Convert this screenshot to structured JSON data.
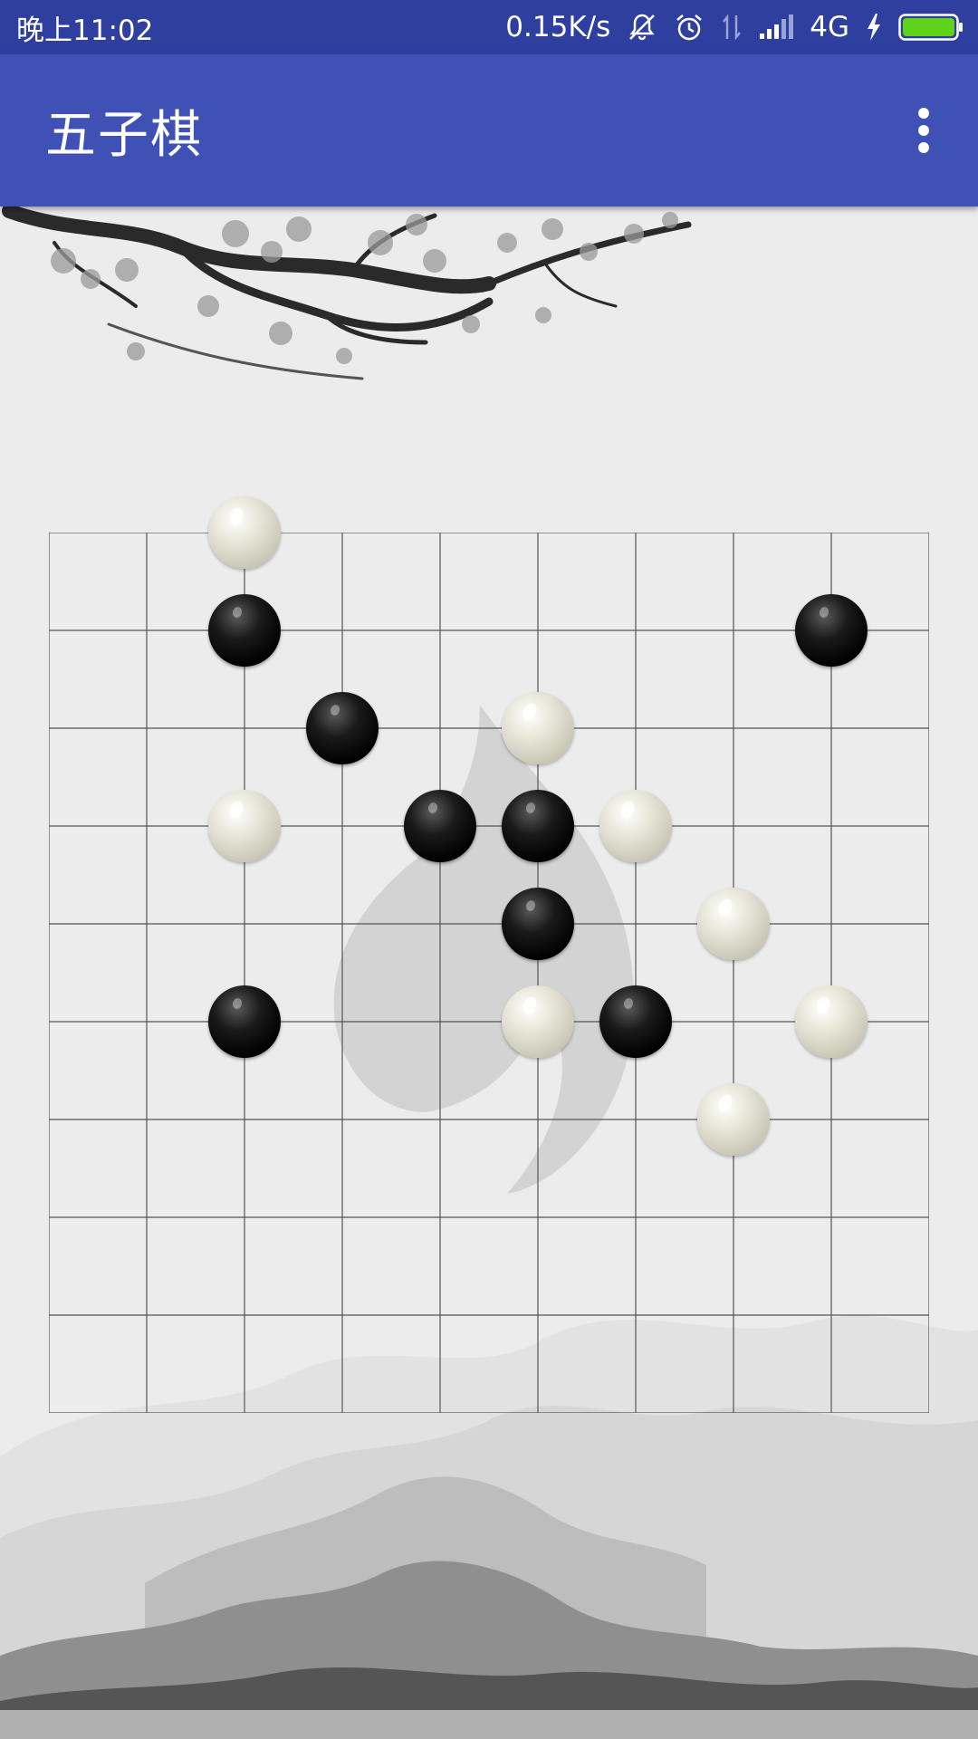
{
  "status_bar": {
    "time": "晚上11:02",
    "speed": "0.15K/s",
    "network": "4G",
    "icons": [
      "silent-icon",
      "alarm-icon",
      "data-arrows-icon",
      "signal-icon",
      "charging-icon",
      "battery-icon"
    ]
  },
  "app_bar": {
    "title": "五子棋",
    "menu_icon": "more-vert-icon",
    "color": "#3f51b5",
    "status_color": "#2f3f9f"
  },
  "board": {
    "lines": 10,
    "stones": [
      {
        "color": "white",
        "col": 2,
        "row": 0
      },
      {
        "color": "black",
        "col": 2,
        "row": 1
      },
      {
        "color": "black",
        "col": 8,
        "row": 1
      },
      {
        "color": "black",
        "col": 3,
        "row": 2
      },
      {
        "color": "white",
        "col": 5,
        "row": 2
      },
      {
        "color": "white",
        "col": 2,
        "row": 3
      },
      {
        "color": "black",
        "col": 4,
        "row": 3
      },
      {
        "color": "black",
        "col": 5,
        "row": 3
      },
      {
        "color": "white",
        "col": 6,
        "row": 3
      },
      {
        "color": "black",
        "col": 5,
        "row": 4
      },
      {
        "color": "white",
        "col": 7,
        "row": 4
      },
      {
        "color": "black",
        "col": 2,
        "row": 5
      },
      {
        "color": "white",
        "col": 5,
        "row": 5
      },
      {
        "color": "black",
        "col": 6,
        "row": 5
      },
      {
        "color": "white",
        "col": 8,
        "row": 5
      },
      {
        "color": "white",
        "col": 7,
        "row": 6
      }
    ]
  }
}
